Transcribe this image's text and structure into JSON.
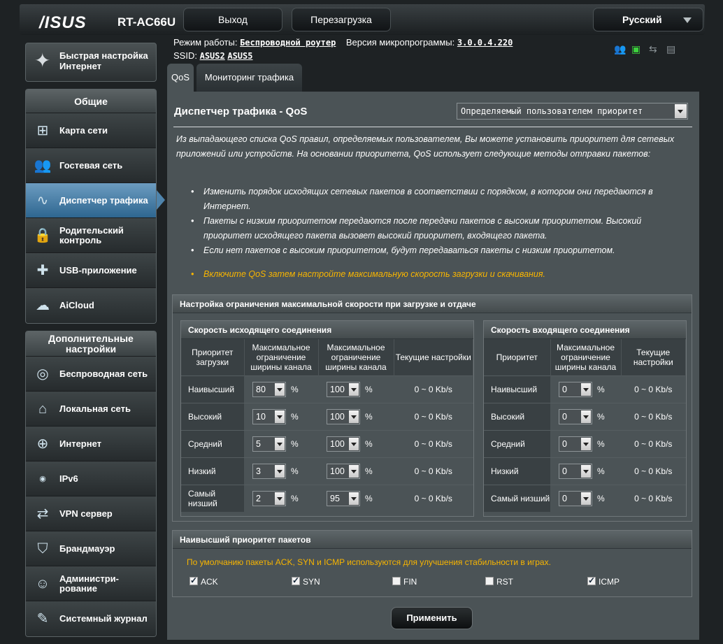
{
  "header": {
    "brand": "/ISUS",
    "model": "RT-AC66U",
    "logout_label": "Выход",
    "reboot_label": "Перезагрузка",
    "language": "Русский"
  },
  "info": {
    "mode_label": "Режим работы:",
    "mode_value": "Беспроводной роутер",
    "fw_label": "Версия микропрограммы:",
    "fw_value": "3.0.0.4.220",
    "ssid_label": "SSID:",
    "ssid_1": "ASUS2",
    "ssid_2": "ASUS5"
  },
  "status_icons": [
    "clients-icon",
    "network-icon",
    "usb-icon",
    "printer-icon"
  ],
  "sidebar": {
    "quick_setup": "Быстрая настройка Интернет",
    "general_title": "Общие",
    "general_items": [
      {
        "label": "Карта сети",
        "icon": "network-map-icon"
      },
      {
        "label": "Гостевая сеть",
        "icon": "guest-network-icon"
      },
      {
        "label": "Диспетчер трафика",
        "icon": "traffic-manager-icon"
      },
      {
        "label": "Родительский контроль",
        "icon": "lock-icon"
      },
      {
        "label": "USB-приложение",
        "icon": "puzzle-icon"
      },
      {
        "label": "AiCloud",
        "icon": "cloud-icon"
      }
    ],
    "advanced_title": "Дополнительные настройки",
    "advanced_items": [
      {
        "label": "Беспроводная сеть",
        "icon": "wifi-icon"
      },
      {
        "label": "Локальная сеть",
        "icon": "home-icon"
      },
      {
        "label": "Интернет",
        "icon": "globe-icon"
      },
      {
        "label": "IPv6",
        "icon": "ipv6-icon"
      },
      {
        "label": "VPN сервер",
        "icon": "vpn-icon"
      },
      {
        "label": "Брандмауэр",
        "icon": "shield-icon"
      },
      {
        "label": "Администри-рование",
        "icon": "admin-icon"
      },
      {
        "label": "Системный журнал",
        "icon": "log-icon"
      }
    ]
  },
  "tabs": [
    "QoS",
    "Мониторинг трафика"
  ],
  "main": {
    "title": "Диспетчер трафика - QoS",
    "mode_select": "Определяемый пользователем приоритет",
    "description": "Из выпадающего списка QoS правил, определяемых пользователем, Вы можете установить приоритет для сетевых приложений или устройств. На основании приоритета, QoS использует следующие методы отправки пакетов:",
    "bullets": [
      "Изменить порядок исходящих сетевых пакетов в соответствии с порядком, в котором они передаются в Интернет.",
      "Пакеты с низким приоритетом передаются после передачи пакетов с высоким приоритетом. Высокий приоритет исходящего пакета вызовет высокий приоритет, входящего пакета.",
      "Если нет пакетов с высоким приоритетом, будут передаваться пакеты с низким приоритетом."
    ],
    "note": "Включите QoS затем настройте максимальную скорость загрузки и скачивания.",
    "bandwidth_title": "Настройка ограничения максимальной скорости при загрузке и отдаче",
    "upload": {
      "title": "Скорость исходящего соединения",
      "headers": [
        "Приоритет загрузки",
        "Максимальное ограничение ширины канала",
        "Максимальное ограничение ширины канала",
        "Текущие настройки"
      ],
      "rows": [
        {
          "priority": "Наивысший",
          "min": "80",
          "max": "100",
          "current": "0 ~ 0 Kb/s"
        },
        {
          "priority": "Высокий",
          "min": "10",
          "max": "100",
          "current": "0 ~ 0 Kb/s"
        },
        {
          "priority": "Средний",
          "min": "5",
          "max": "100",
          "current": "0 ~ 0 Kb/s"
        },
        {
          "priority": "Низкий",
          "min": "3",
          "max": "100",
          "current": "0 ~ 0 Kb/s"
        },
        {
          "priority": "Самый низший",
          "min": "2",
          "max": "95",
          "current": "0 ~ 0 Kb/s"
        }
      ]
    },
    "download": {
      "title": "Скорость входящего соединения",
      "headers": [
        "Приоритет",
        "Максимальное ограничение ширины канала",
        "Текущие настройки"
      ],
      "rows": [
        {
          "priority": "Наивысший",
          "value": "0",
          "current": "0 ~ 0 Kb/s"
        },
        {
          "priority": "Высокий",
          "value": "0",
          "current": "0 ~ 0 Kb/s"
        },
        {
          "priority": "Средний",
          "value": "0",
          "current": "0 ~ 0 Kb/s"
        },
        {
          "priority": "Низкий",
          "value": "0",
          "current": "0 ~ 0 Kb/s"
        },
        {
          "priority": "Самый низший",
          "value": "0",
          "current": "0 ~ 0 Kb/s"
        }
      ]
    },
    "percent": "%",
    "packets_title": "Наивысший приоритет пакетов",
    "packets_note": "По умолчанию пакеты ACK, SYN и ICMP используются для улучшения стабильности в играх.",
    "packets": [
      {
        "label": "ACK",
        "checked": true
      },
      {
        "label": "SYN",
        "checked": true
      },
      {
        "label": "FIN",
        "checked": false
      },
      {
        "label": "RST",
        "checked": false
      },
      {
        "label": "ICMP",
        "checked": true
      }
    ],
    "apply_label": "Применить"
  }
}
